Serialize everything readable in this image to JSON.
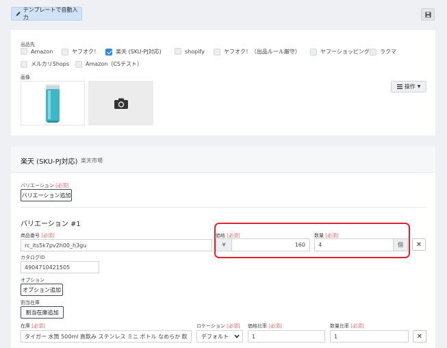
{
  "toolbar": {
    "template_label": "テンプレートで自動入力",
    "pencil_icon": "pencil-icon",
    "save_icon": "floppy-disk-icon"
  },
  "listing": {
    "destination_label": "出品先",
    "marketplaces": [
      {
        "label": "Amazon",
        "checked": false
      },
      {
        "label": "ヤフオク！",
        "checked": false
      },
      {
        "label": "楽天 (SKU-PJ対応)",
        "checked": true
      },
      {
        "label": "shopify",
        "checked": false
      },
      {
        "label": "ヤフオク！（出品ルール厳守）",
        "checked": false
      },
      {
        "label": "ヤフーショッピング",
        "checked": false
      },
      {
        "label": "ラクマ",
        "checked": false
      },
      {
        "label": "メルカリShops",
        "checked": false
      },
      {
        "label": "Amazon（CSテスト）",
        "checked": false
      }
    ],
    "image_label": "画像",
    "ops_label": "操作"
  },
  "rakuten": {
    "title": "楽天 (SKU-PJ対応)",
    "subtitle": "楽天市場",
    "variation_label": "バリエーション",
    "required": "[必須]",
    "add_variation": "バリエーション追加",
    "variation_title": "バリエーション #1",
    "product_no_label": "商品番号",
    "product_no_value": "rc_its5k7pv2h00_h3gu",
    "price_label": "価格",
    "currency": "¥",
    "price_value": "160",
    "qty_label": "数量",
    "qty_value": "4",
    "qty_unit": "個",
    "catalog_label": "カタログID",
    "catalog_value": "4904710421505",
    "option_label": "オプション",
    "add_option": "オプション追加",
    "alloc_label": "割当在庫",
    "add_alloc": "割当在庫追加",
    "stock_label": "在庫",
    "stock_value": "タイガー 水筒 500ml 直飲み ステンレス ミニ ボトル なめらか 飲",
    "rotation_label": "ロケーション",
    "rotation_value": "デフォルト",
    "price_ratio_label": "価格比率",
    "price_ratio_value": "1",
    "qty_ratio_label": "数量比率",
    "qty_ratio_value": "1",
    "remove_icon": "close-icon"
  }
}
